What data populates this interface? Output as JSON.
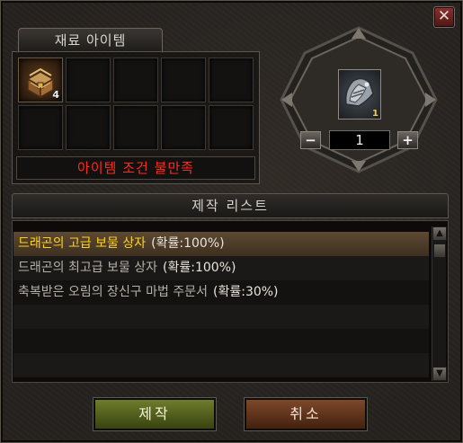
{
  "window": {
    "close_label": "✕"
  },
  "material": {
    "tab_label": "재료 아이템",
    "slots": [
      {
        "icon": "treasure-chest-icon",
        "count": "4"
      },
      {},
      {},
      {},
      {},
      {},
      {},
      {},
      {},
      {}
    ],
    "condition_text": "아이템 조건 불만족"
  },
  "product": {
    "icon": "armor-gauntlet-icon",
    "count": "1",
    "quantity": "1",
    "minus_label": "−",
    "plus_label": "+"
  },
  "craft_list": {
    "header": "제작 리스트",
    "items": [
      {
        "name": "드래곤의 고급 보물 상자",
        "prob": "(확률:100%)",
        "selected": true
      },
      {
        "name": "드래곤의 최고급 보물 상자",
        "prob": "(확률:100%)",
        "selected": false
      },
      {
        "name": "축복받은 오림의 장신구 마법 주문서",
        "prob": "(확률:30%)",
        "selected": false
      }
    ],
    "empty_rows": 3,
    "scroll_up": "▲",
    "scroll_down": "▼"
  },
  "buttons": {
    "craft_label": "제작",
    "cancel_label": "취소"
  },
  "colors": {
    "condition_text": "#ff2a1a",
    "selected_item_text": "#ffd21a",
    "craft_button": "#5c6b20",
    "cancel_button": "#6d3b1f"
  }
}
